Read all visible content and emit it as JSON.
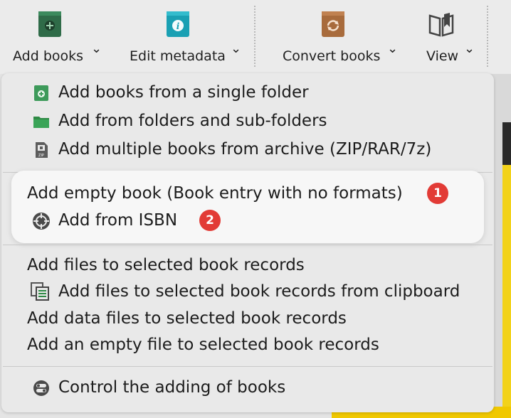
{
  "toolbar": {
    "add_books": {
      "label": "Add books",
      "icon": "book-plus-icon"
    },
    "edit_metadata": {
      "label": "Edit metadata",
      "icon": "book-info-icon"
    },
    "convert_books": {
      "label": "Convert books",
      "icon": "book-convert-icon"
    },
    "view": {
      "label": "View",
      "icon": "open-book-icon"
    },
    "arrow": "⌄"
  },
  "menu": {
    "items_group1": [
      {
        "label": "Add books from a single folder",
        "icon": "green-book-plus-icon"
      },
      {
        "label": "Add from folders and sub-folders",
        "icon": "green-folder-icon"
      },
      {
        "label": "Add multiple books from archive (ZIP/RAR/7z)",
        "icon": "zip-archive-icon"
      }
    ],
    "items_group2": [
      {
        "label": "Add empty book (Book entry with no formats)",
        "badge": "1"
      },
      {
        "label": "Add from ISBN",
        "icon": "crosshair-icon",
        "badge": "2"
      }
    ],
    "items_group3": [
      {
        "label": "Add files to selected book records"
      },
      {
        "label": "Add files to selected book records from clipboard",
        "icon": "clipboard-copy-icon"
      },
      {
        "label": "Add data files to selected book records"
      },
      {
        "label": "Add an empty file to selected book records"
      }
    ],
    "items_group4": [
      {
        "label": "Control the adding of books",
        "icon": "toggle-settings-icon"
      }
    ]
  },
  "colors": {
    "badge": "#e23b36",
    "add_icon_green": "#2f6b48",
    "edit_icon_teal": "#1aa0b3",
    "convert_icon_brown": "#a86b3c"
  }
}
